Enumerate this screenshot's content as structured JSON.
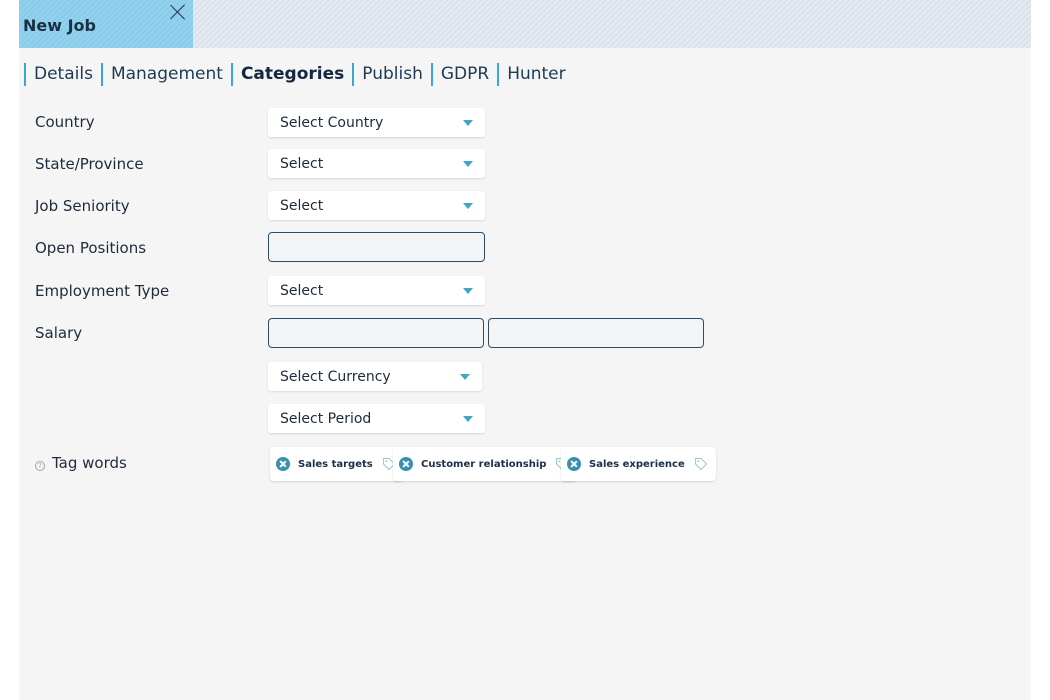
{
  "window": {
    "title": "New Job",
    "close_icon": "close-icon"
  },
  "tabs": [
    {
      "label": "Details",
      "active": false
    },
    {
      "label": "Management",
      "active": false
    },
    {
      "label": "Categories",
      "active": true
    },
    {
      "label": "Publish",
      "active": false
    },
    {
      "label": "GDPR",
      "active": false
    },
    {
      "label": "Hunter",
      "active": false
    }
  ],
  "form": {
    "country": {
      "label": "Country",
      "value": "Select Country"
    },
    "state": {
      "label": "State/Province",
      "value": "Select"
    },
    "seniority": {
      "label": "Job Seniority",
      "value": "Select"
    },
    "open_positions": {
      "label": "Open Positions",
      "value": ""
    },
    "employment_type": {
      "label": "Employment Type",
      "value": "Select"
    },
    "salary": {
      "label": "Salary",
      "min": "",
      "max": ""
    },
    "currency": {
      "value": "Select Currency"
    },
    "period": {
      "value": "Select Period"
    },
    "tag_words": {
      "label": "Tag words",
      "help_icon": "?",
      "tags": [
        "Sales targets",
        "Customer relationship",
        "Sales experience"
      ]
    }
  },
  "colors": {
    "accent": "#37a8d3",
    "tab_header": "#8fd0ec",
    "caret": "#3fa6c6",
    "tag_remove": "#3a8fb0"
  }
}
